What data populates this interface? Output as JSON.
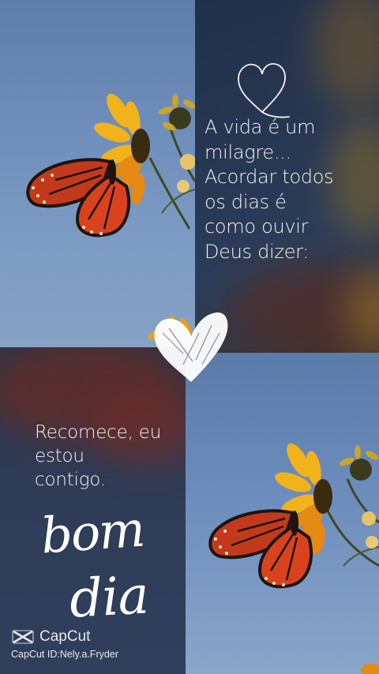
{
  "message_top": {
    "lines": [
      "A vida é um",
      "milagre...",
      "Acordar todos",
      "os dias é",
      "como ouvir",
      "Deus dizer:"
    ]
  },
  "message_bottom": {
    "lines": [
      "Recomece, eu",
      "estou",
      "contigo."
    ]
  },
  "greeting": {
    "line1": "bom",
    "line2": "dia"
  },
  "watermark": {
    "brand": "CapCut",
    "id_text": "CapCut ID:Nely.a.Fryder"
  },
  "icons": [
    "heart-outline-icon",
    "heart-brush-icon",
    "capcut-logo-icon"
  ],
  "colors": {
    "sky_blue": "#6f8fbc",
    "dark_navy": "#273854",
    "text_white": "#f4f2ee",
    "butterfly_orange": "#d8431e",
    "flower_yellow": "#f2b21c"
  }
}
